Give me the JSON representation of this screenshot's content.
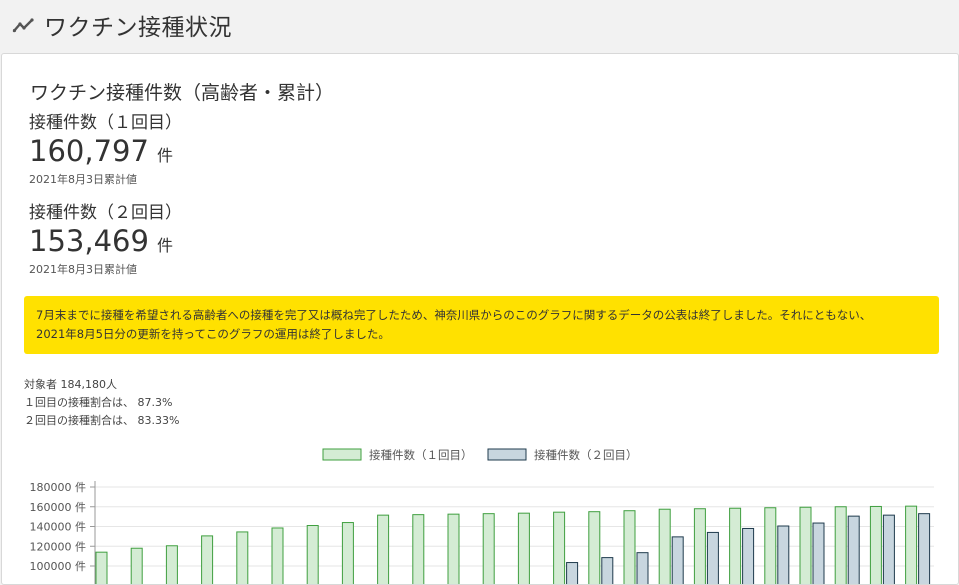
{
  "header": {
    "title": "ワクチン接種状況"
  },
  "card": {
    "title": "ワクチン接種件数（高齢者・累計）"
  },
  "stats": [
    {
      "label": "接種件数（１回目）",
      "value": "160,797",
      "unit": "件",
      "note": "2021年8月3日累計値"
    },
    {
      "label": "接種件数（２回目）",
      "value": "153,469",
      "unit": "件",
      "note": "2021年8月3日累計値"
    }
  ],
  "notice": {
    "line1": "7月末までに接種を希望される高齢者への接種を完了又は概ね完了したため、神奈川県からのこのグラフに関するデータの公表は終了しました。それにともない、",
    "line2": "2021年8月5日分の更新を持ってこのグラフの運用は終了しました。"
  },
  "meta": {
    "target": "対象者 184,180人",
    "rate1": "１回目の接種割合は、 87.3%",
    "rate2": "２回目の接種割合は、 83.33%"
  },
  "colors": {
    "first_fill": "#d4ecd4",
    "first_stroke": "#3f9f3f",
    "second_fill": "#c8d6df",
    "second_stroke": "#1f3b4d",
    "notice": "#ffe100"
  },
  "chart_data": {
    "type": "bar",
    "legend_position": "top-center",
    "grid": true,
    "y_tick_labels": [
      "180000 件",
      "160000 件",
      "140000 件",
      "120000 件",
      "100000 件"
    ],
    "ylim_visible": [
      100000,
      180000
    ],
    "series": [
      {
        "name": "接種件数（１回目）",
        "values": [
          114000,
          118000,
          120500,
          130500,
          134500,
          138500,
          141000,
          144000,
          151500,
          152000,
          152500,
          153000,
          153500,
          154500,
          155000,
          156000,
          157500,
          158000,
          158500,
          159000,
          159500,
          160000,
          160300,
          160600
        ]
      },
      {
        "name": "接種件数（２回目）",
        "values": [
          null,
          null,
          null,
          null,
          null,
          null,
          null,
          null,
          null,
          null,
          null,
          null,
          null,
          103500,
          108500,
          113500,
          129500,
          134000,
          138000,
          140500,
          143500,
          150500,
          151500,
          153000
        ]
      }
    ]
  }
}
